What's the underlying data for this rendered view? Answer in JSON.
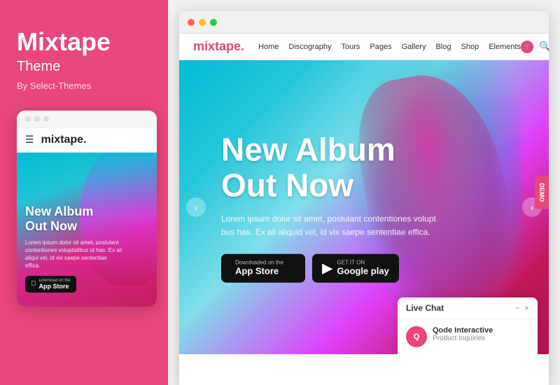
{
  "leftPanel": {
    "title": "Mixtape",
    "subtitle": "Theme",
    "by": "By Select-Themes"
  },
  "mobilePreview": {
    "logo": "mixtape.",
    "heroTitle": "New Album\nOut Now",
    "heroText": "Lorem ipsum dolor sit amet, postulant contentiones voluptatibus ut has. Ex ali aliqui vel, id vix saepe sententiae effica.",
    "appstoreLabel": "App Store",
    "appstoreTop": "Download on the"
  },
  "desktopPreview": {
    "logo": "mixtape.",
    "nav": {
      "items": [
        "Home",
        "Discography",
        "Tours",
        "Pages",
        "Gallery",
        "Blog",
        "Shop",
        "Elements"
      ]
    },
    "hero": {
      "title": "New Album\nOut Now",
      "description": "Lorem ipsum dolor sit amet, postulant contentiones volupt bus has. Ex ali aliquid vel, id vix saepe sententiae effica.",
      "appstoreBtn": {
        "top": "Downloaded on the",
        "label": "App Store"
      },
      "googleplayBtn": {
        "top": "GET IT ON",
        "label": "Google play"
      }
    }
  },
  "liveChat": {
    "title": "Live Chat",
    "agentName": "Qode Interactive",
    "agentStatus": "Product Inquiries",
    "minimizeLabel": "−",
    "closeLabel": "×"
  },
  "carousel": {
    "prevArrow": "‹",
    "nextArrow": "›"
  }
}
